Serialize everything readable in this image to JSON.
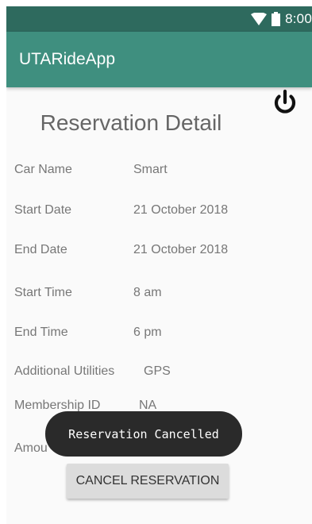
{
  "status_bar": {
    "time": "8:00",
    "icons": [
      "wifi-icon",
      "battery-icon"
    ]
  },
  "app_bar": {
    "title": "UTARideApp"
  },
  "power_icon": "power-icon",
  "page": {
    "heading": "Reservation Detail"
  },
  "details": {
    "car_name": {
      "label": "Car Name",
      "value": "Smart"
    },
    "start_date": {
      "label": "Start Date",
      "value": "21 October 2018"
    },
    "end_date": {
      "label": "End Date",
      "value": "21 October 2018"
    },
    "start_time": {
      "label": "Start Time",
      "value": "8 am"
    },
    "end_time": {
      "label": "End Time",
      "value": "6 pm"
    },
    "additional_utilities": {
      "label": "Additional Utilities",
      "value": "GPS"
    },
    "membership_id": {
      "label": "Membership ID",
      "value": "NA"
    },
    "amount": {
      "label": "Amou"
    }
  },
  "actions": {
    "cancel_label": "CANCEL RESERVATION"
  },
  "toast": {
    "message": "Reservation Cancelled"
  },
  "colors": {
    "status_bar": "#2e6a5e",
    "app_bar": "#3f8f7f",
    "toast_bg": "#2a2a2a",
    "button_bg": "#dcdcdc"
  }
}
